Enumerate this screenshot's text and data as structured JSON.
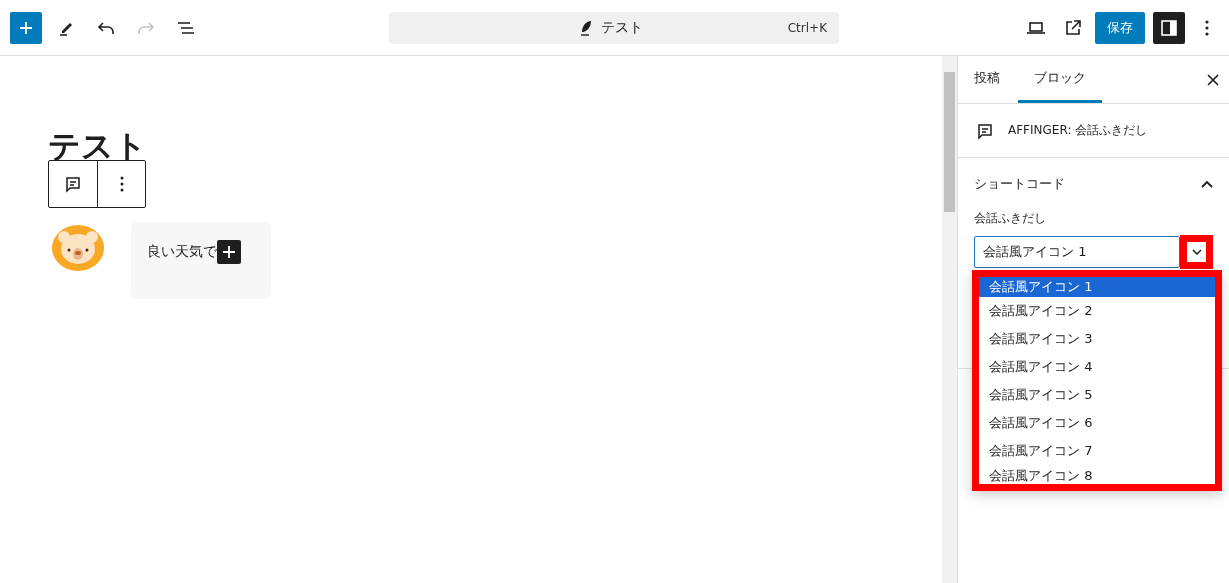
{
  "toolbar": {
    "tools": [
      {
        "kind": "add",
        "disabled": false
      },
      {
        "kind": "edit",
        "disabled": false
      },
      {
        "kind": "undo",
        "disabled": false
      },
      {
        "kind": "redo",
        "disabled": true
      },
      {
        "kind": "outline",
        "disabled": false
      }
    ]
  },
  "command_bar": {
    "title": "テスト",
    "shortcut": "Ctrl+K"
  },
  "actions": {
    "save": "保存",
    "settings_on": true
  },
  "editor": {
    "title": "テスト",
    "bubble_text": "良い天気で"
  },
  "sidebar": {
    "tabs": [
      {
        "label": "投稿",
        "selected": false
      },
      {
        "label": "ブロック",
        "selected": true
      }
    ],
    "block_name": "AFFINGER: 会話ふきだし",
    "panel": {
      "title": "ショートコード",
      "expanded": true,
      "field_label": "会話ふきだし",
      "value": "会話風アイコン 1",
      "options": [
        {
          "label": "会話風アイコン 1",
          "selected": true
        },
        {
          "label": "会話風アイコン 2",
          "selected": false
        },
        {
          "label": "会話風アイコン 3",
          "selected": false
        },
        {
          "label": "会話風アイコン 4",
          "selected": false
        },
        {
          "label": "会話風アイコン 5",
          "selected": false
        },
        {
          "label": "会話風アイコン 6",
          "selected": false
        },
        {
          "label": "会話風アイコン 7",
          "selected": false
        },
        {
          "label": "会話風アイコン 8",
          "selected": false
        }
      ]
    }
  }
}
